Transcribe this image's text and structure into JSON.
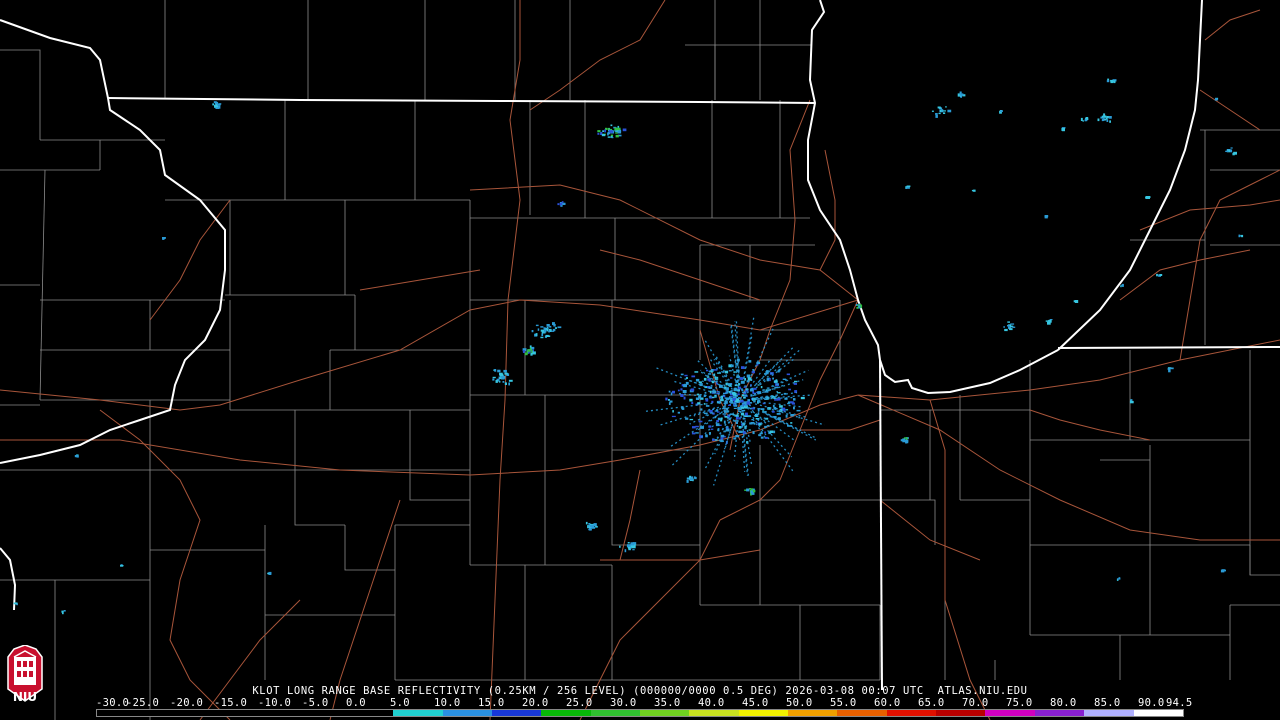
{
  "title": "KLOT LONG RANGE BASE REFLECTIVITY (0.25KM / 256 LEVEL) (000000/0000 0.5 DEG) 2026-03-08 00:07 UTC  ATLAS.NIU.EDU",
  "logo_text": "NIU",
  "colors": {
    "background": "#000000",
    "state_border": "#ffffff",
    "county_border": "#8c8c8c",
    "highway": "#a8553a",
    "echo_light": "#2a9bd6",
    "echo_mid": "#36c6e0",
    "echo_green": "#30c040",
    "echo_blue": "#2a50d8"
  },
  "scale": {
    "labels": [
      "-30.0",
      "-25.0",
      "-20.0",
      "-15.0",
      "-10.0",
      "-5.0",
      "0.0",
      "5.0",
      "10.0",
      "15.0",
      "20.0",
      "25.0",
      "30.0",
      "35.0",
      "40.0",
      "45.0",
      "50.0",
      "55.0",
      "60.0",
      "65.0",
      "70.0",
      "75.0",
      "80.0",
      "85.0",
      "90.0",
      "94.5"
    ],
    "colors": [
      "#000000",
      "#000000",
      "#000000",
      "#000000",
      "#000000",
      "#000000",
      "#20d0d0",
      "#2a90e0",
      "#1838d8",
      "#08b808",
      "#30c030",
      "#70d020",
      "#c8e020",
      "#f0f000",
      "#f0a000",
      "#e86000",
      "#e01000",
      "#b80000",
      "#d000c0",
      "#8820d0",
      "#b0b0ff",
      "#ffffff"
    ]
  }
}
